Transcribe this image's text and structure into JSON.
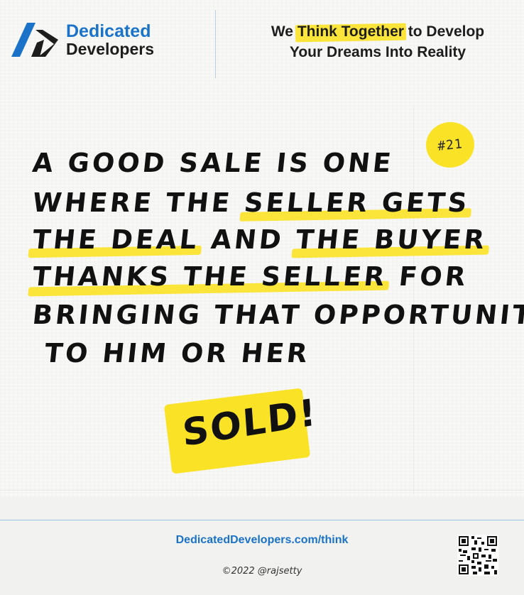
{
  "header": {
    "brand_line1": "Dedicated",
    "brand_line2": "Developers",
    "tagline_prefix": "We ",
    "tagline_highlight": "Think Together",
    "tagline_suffix": " to Develop",
    "tagline_line2": "Your Dreams Into Reality"
  },
  "badge": {
    "label": "#21"
  },
  "quote": {
    "lines": [
      [
        "A GOOD SALE IS ONE"
      ],
      [
        "WHERE THE ",
        "SELLER GETS"
      ],
      [
        "THE DEAL",
        " AND ",
        "THE BUYER"
      ],
      [
        "THANKS THE SELLER",
        " FOR"
      ],
      [
        "BRINGING THAT OPPORTUNITY"
      ],
      [
        " TO HIM OR HER"
      ]
    ]
  },
  "sold": {
    "label": "SOLD!"
  },
  "footer": {
    "url": "DedicatedDevelopers.com/think",
    "copyright": "©2022 @rajsetty"
  },
  "colors": {
    "brand_blue": "#1a73c9",
    "highlight_yellow": "#fbe53b",
    "text_dark": "#1d1d1d"
  },
  "icons": {
    "logo": "dedicated-developers-logo-icon",
    "qr": "qr-code-icon"
  }
}
